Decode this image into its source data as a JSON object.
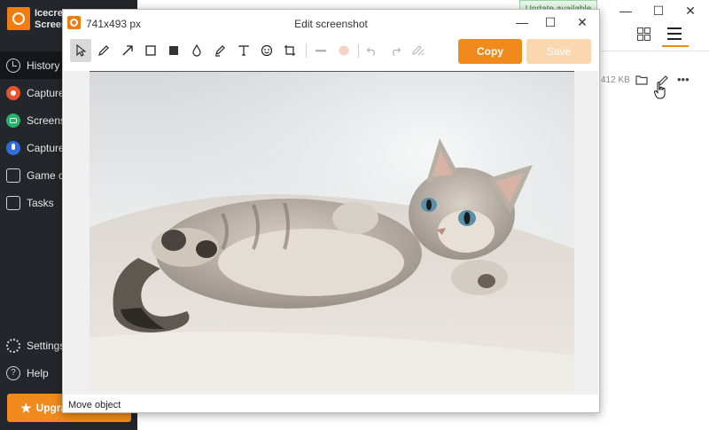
{
  "app": {
    "name_line1": "Icecream",
    "name_line2": "Screen"
  },
  "sidebar": {
    "items": [
      {
        "label": "History",
        "icon": "clock-icon"
      },
      {
        "label": "Capture",
        "icon": "record-icon"
      },
      {
        "label": "Screenshot",
        "icon": "camera-icon"
      },
      {
        "label": "Capture",
        "icon": "microphone-icon"
      },
      {
        "label": "Game capture",
        "icon": "gamepad-icon"
      },
      {
        "label": "Tasks",
        "icon": "tasks-icon"
      }
    ],
    "settings_label": "Settings",
    "help_label": "Help",
    "upgrade_label": "Upgrade"
  },
  "main": {
    "update_badge": "Update available",
    "row_size": "412 KB"
  },
  "dialog": {
    "size_label": "741x493 px",
    "title": "Edit screenshot",
    "copy_label": "Copy",
    "save_label": "Save",
    "status": "Move object"
  },
  "colors": {
    "accent": "#f08a1c",
    "sidebar_bg": "#23262b",
    "save_disabled": "#fbd7b0"
  }
}
